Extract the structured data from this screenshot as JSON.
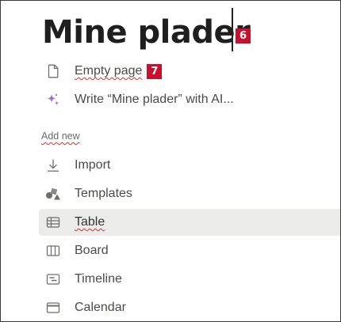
{
  "page": {
    "title": "Mine plader",
    "title_badge": "6"
  },
  "options": [
    {
      "label": "Empty page",
      "icon": "page-icon",
      "badge": "7"
    },
    {
      "label": "Write “Mine plader” with AI...",
      "icon": "ai-sparkle-icon"
    }
  ],
  "add_new": {
    "label": "Add new",
    "items": [
      {
        "label": "Import",
        "icon": "import-icon"
      },
      {
        "label": "Templates",
        "icon": "templates-icon"
      },
      {
        "label": "Table",
        "icon": "table-icon",
        "selected": true
      },
      {
        "label": "Board",
        "icon": "board-icon"
      },
      {
        "label": "Timeline",
        "icon": "timeline-icon"
      },
      {
        "label": "Calendar",
        "icon": "calendar-icon"
      }
    ]
  },
  "colors": {
    "badge": "#c8102e",
    "ai_accent": "#9b6fd1",
    "selected_row": "#ebebea",
    "spellcheck": "#d0342c"
  }
}
